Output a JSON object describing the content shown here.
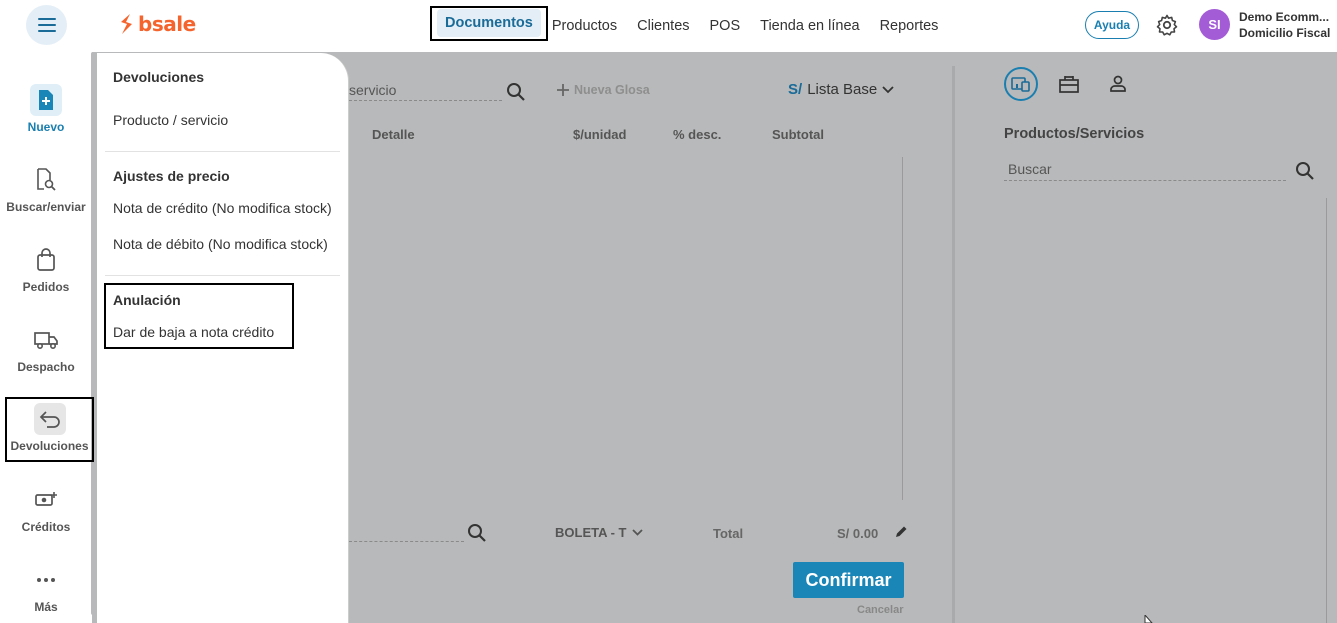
{
  "topbar": {
    "brand": "bsale",
    "nav": [
      "Documentos",
      "Productos",
      "Clientes",
      "POS",
      "Tienda en línea",
      "Reportes"
    ],
    "help_label": "Ayuda",
    "avatar_initials": "SI",
    "company_name": "Demo Ecomm...",
    "company_sub": "Domicilio Fiscal"
  },
  "sidebar": {
    "items": [
      {
        "label": "Nuevo",
        "icon": "file-plus-icon"
      },
      {
        "label": "Buscar/enviar",
        "icon": "file-search-icon"
      },
      {
        "label": "Pedidos",
        "icon": "bag-icon"
      },
      {
        "label": "Despacho",
        "icon": "truck-icon"
      },
      {
        "label": "Devoluciones",
        "icon": "return-arrow-icon"
      },
      {
        "label": "Créditos",
        "icon": "money-plus-icon"
      },
      {
        "label": "Más",
        "icon": "more-dots-icon"
      }
    ]
  },
  "flyout": {
    "title": "Devoluciones",
    "item_product": "Producto / servicio",
    "section_price": "Ajustes de precio",
    "item_credit": "Nota de crédito (No modifica stock)",
    "item_debit": "Nota de débito (No modifica stock)",
    "section_annul": "Anulación",
    "item_annul": "Dar de baja a nota crédito"
  },
  "document": {
    "search_placeholder": "servicio",
    "new_gloss": "Nueva Glosa",
    "currency_symbol": "S/",
    "price_list": "Lista Base",
    "columns": [
      "Detalle",
      "$/unidad",
      "% desc.",
      "Subtotal"
    ],
    "doc_type": "BOLETA - T",
    "total_label": "Total",
    "total_value": "S/ 0.00",
    "confirm": "Confirmar",
    "cancel": "Cancelar"
  },
  "right_panel": {
    "title": "Productos/Servicios",
    "search_placeholder": "Buscar"
  },
  "colors": {
    "accent": "#1a7fb0",
    "brand": "#f5642d",
    "overlay": "#b8b9ba",
    "avatar": "#a35cd6"
  }
}
